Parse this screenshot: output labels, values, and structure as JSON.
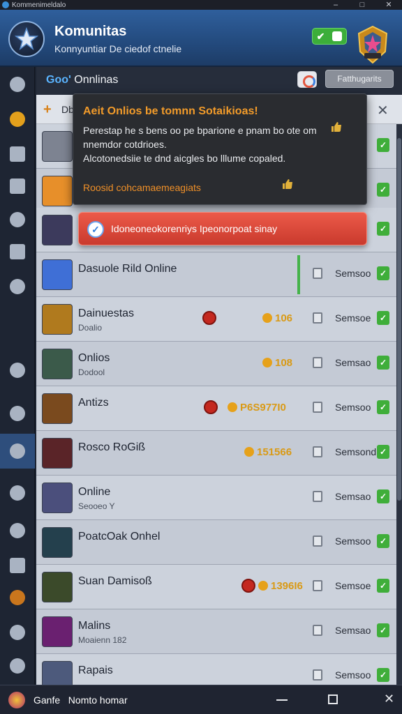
{
  "titlebar": {
    "title": "Kommenimeldalo",
    "minimize": "–",
    "maximize": "□",
    "close": "✕"
  },
  "header": {
    "title": "Komunitas",
    "subtitle": "Konnyuntiar De ciedof ctnelie",
    "toggle_label": "✔"
  },
  "section": {
    "label_prefix": "Goo'",
    "label_rest": " Onnlinas",
    "search_placeholder": "Fatthugarits"
  },
  "strip": {
    "text": "Db",
    "close": "✕"
  },
  "popup": {
    "title": "Aeit Onlios be tomnn Sotaikioas!",
    "body": "Perestap he s bens oo pe bparione e pnam bo ote om nnemdor cotdrioes.",
    "body2": "Alcotonedsiie te dnd aicgles bo lllume copaled.",
    "link": "Roosid cohcamaemeagiats"
  },
  "alert": {
    "text": "Idoneoneokorenriys Ipeonorpoat sinay"
  },
  "rows": [
    {
      "name": "",
      "sub": "",
      "status": "",
      "thumb_color": "#7d8391"
    },
    {
      "name": "",
      "sub": "",
      "status": "",
      "thumb_color": "#e78f2a"
    },
    {
      "name": "",
      "sub": "",
      "status": "",
      "thumb_color": "#3c3a5c"
    },
    {
      "name": "Dasuole Rild Online",
      "sub": "",
      "status": "Semsoo",
      "thumb_color": "#3f6fd6"
    },
    {
      "name": "Dainuestas",
      "sub": "Doalio",
      "coin": "106",
      "status": "Semsoe",
      "thumb_color": "#b07a1e"
    },
    {
      "name": "Onlios",
      "sub": "Dodool",
      "coin": "108",
      "status": "Semsao",
      "thumb_color": "#3b5a4a"
    },
    {
      "name": "Antizs",
      "sub": "",
      "coin": "P6S977I0",
      "status": "Semsoo",
      "thumb_color": "#7a4a1e"
    },
    {
      "name": "Rosco RoGiß",
      "sub": "",
      "coin": "151566",
      "status": "Semsond",
      "thumb_color": "#5a2428"
    },
    {
      "name": "Online",
      "sub": "Seooeo Y",
      "status": "Semsao",
      "thumb_color": "#4b4f7c"
    },
    {
      "name": "PoatcOak Onhel",
      "sub": "",
      "status": "Semsoo",
      "thumb_color": "#24404d"
    },
    {
      "name": "Suan Damisoß",
      "sub": "",
      "coin": "1396I6",
      "status": "Semsoe",
      "thumb_color": "#3b4a2a"
    },
    {
      "name": "Malins",
      "sub": "Moaienn 182",
      "status": "Semsao",
      "thumb_color": "#6a2070"
    },
    {
      "name": "Rapais",
      "sub": "",
      "status": "Semsoo",
      "thumb_color": "#4d5a7c"
    }
  ],
  "bottombar": {
    "text": "Ganfe    Nomto homar"
  },
  "colors": {
    "accent": "#2f5f9c",
    "success": "#3fae3a",
    "warning": "#f29b2a",
    "danger": "#c93a2d"
  }
}
